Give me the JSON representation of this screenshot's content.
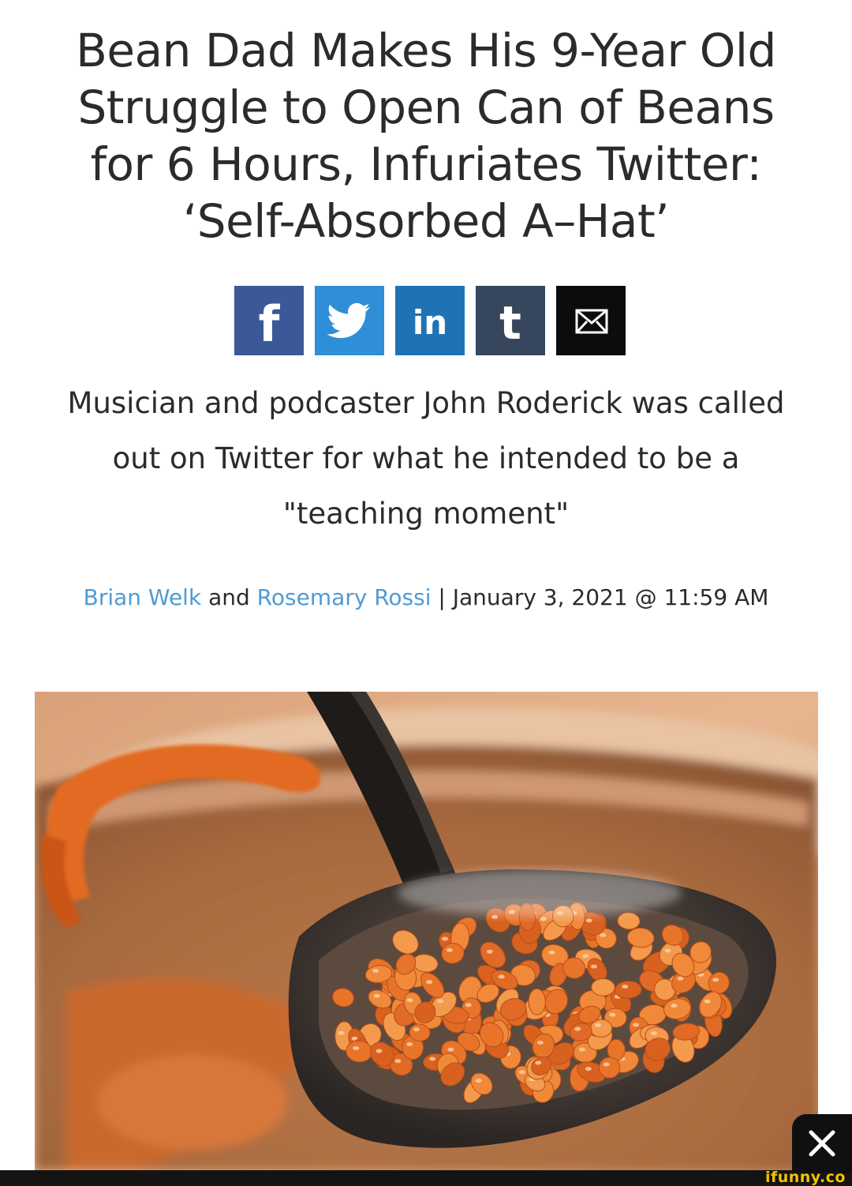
{
  "article": {
    "headline": "Bean Dad Makes His 9-Year Old Struggle to Open Can of Beans for 6 Hours, Infuriates Twitter: ‘Self-Absorbed A–Hat’",
    "dek": "Musician and podcaster John Roderick was called out on Twitter for what he intended to be a \"teaching moment\"",
    "byline": {
      "author_1": "Brian Welk",
      "joiner": " and ",
      "author_2": "Rosemary Rossi",
      "separator": " | ",
      "date": "January 3, 2021 @ 11:59 AM"
    }
  },
  "share": {
    "facebook_glyph": "f",
    "linkedin_glyph": "in",
    "tumblr_glyph": "t",
    "icons": [
      "facebook-icon",
      "twitter-icon",
      "linkedin-icon",
      "tumblr-icon",
      "email-icon"
    ],
    "colors": {
      "facebook": "#3b5998",
      "twitter": "#2e8fd8",
      "linkedin": "#1f73b5",
      "tumblr": "#36465d",
      "email": "#0c0c0c"
    }
  },
  "overlay": {
    "close_icon": "close-icon",
    "watermark": "ifunny.co"
  },
  "colors": {
    "author_link": "#4f9bd4",
    "text": "#2b2b2b"
  }
}
